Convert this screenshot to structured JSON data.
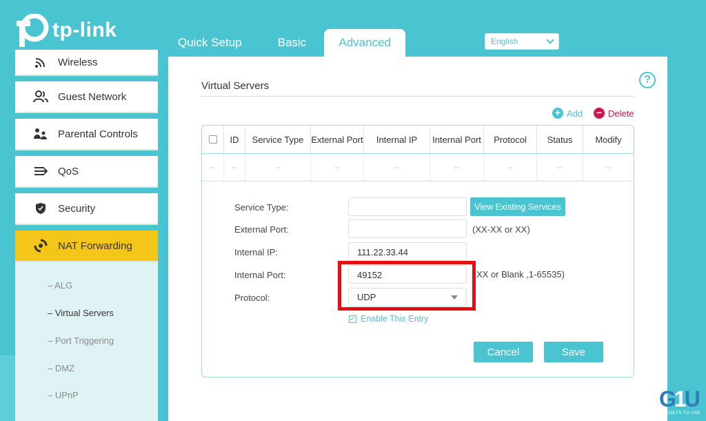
{
  "brand": {
    "logo_text": "tp-link"
  },
  "top_nav": {
    "tabs": [
      "Quick Setup",
      "Basic",
      "Advanced"
    ],
    "active": "Advanced"
  },
  "language": {
    "selected": "English"
  },
  "sidebar": {
    "items": [
      {
        "label": "Wireless",
        "icon": "wifi-icon"
      },
      {
        "label": "Guest Network",
        "icon": "users-icon"
      },
      {
        "label": "Parental Controls",
        "icon": "family-icon"
      },
      {
        "label": "QoS",
        "icon": "qos-icon"
      },
      {
        "label": "Security",
        "icon": "shield-icon"
      },
      {
        "label": "NAT Forwarding",
        "icon": "nat-icon"
      }
    ],
    "subitems": [
      "ALG",
      "Virtual Servers",
      "Port Triggering",
      "DMZ",
      "UPnP"
    ],
    "active_subitem": "Virtual Servers"
  },
  "page": {
    "title": "Virtual Servers",
    "add_label": "Add",
    "delete_label": "Delete",
    "table": {
      "headers": [
        "ID",
        "Service Type",
        "External Port",
        "Internal IP",
        "Internal Port",
        "Protocol",
        "Status",
        "Modify"
      ],
      "empty_cell": "--"
    },
    "form": {
      "service_type_label": "Service Type:",
      "service_type_value": "",
      "view_services_label": "View Existing Services",
      "external_port_label": "External Port:",
      "external_port_value": "",
      "external_port_hint": "(XX-XX or XX)",
      "internal_ip_label": "Internal IP:",
      "internal_ip_value": "111.22.33.44",
      "internal_port_label": "Internal Port:",
      "internal_port_value": "49152",
      "internal_port_hint": "XX or Blank ,1-65535)",
      "protocol_label": "Protocol:",
      "protocol_value": "UDP",
      "enable_label": "Enable This Entry",
      "enable_checked": true,
      "cancel_label": "Cancel",
      "save_label": "Save"
    }
  },
  "watermark": {
    "text": "GADGETS TO USE"
  },
  "colors": {
    "accent": "#4bc4d1",
    "active_menu": "#f4c61a",
    "delete": "#c9184a",
    "highlight": "#e40f12"
  }
}
